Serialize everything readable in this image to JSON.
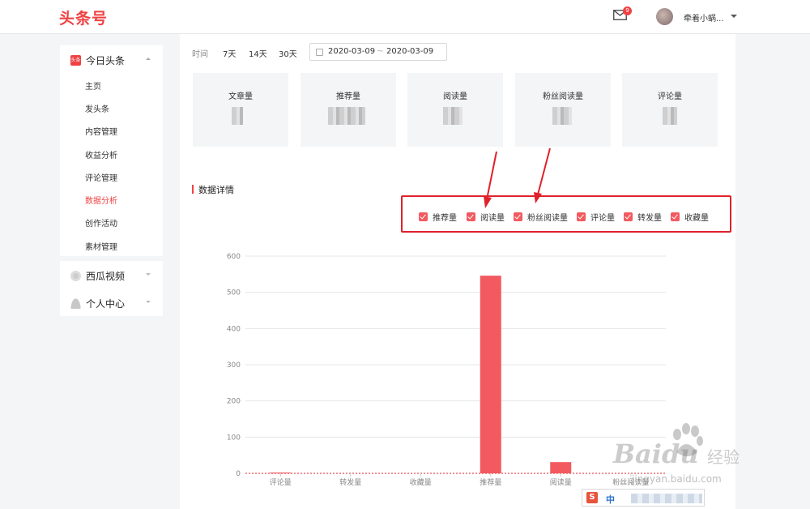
{
  "header": {
    "logo": "头条号",
    "mail_badge": "9",
    "username": "牵着小蜗..."
  },
  "sidebar": {
    "group1": {
      "title": "今日头条",
      "icon_text": "头条",
      "items": [
        "主页",
        "发头条",
        "内容管理",
        "收益分析",
        "评论管理",
        "数据分析",
        "创作活动",
        "素材管理"
      ],
      "active": "数据分析"
    },
    "group2": {
      "title": "西瓜视频"
    },
    "group3": {
      "title": "个人中心"
    }
  },
  "filter": {
    "label": "时间",
    "options": [
      "7天",
      "14天",
      "30天"
    ],
    "date_start": "2020-03-09",
    "date_sep": "~",
    "date_end": "2020-03-09"
  },
  "stats": [
    {
      "label": "文章量"
    },
    {
      "label": "推荐量"
    },
    {
      "label": "阅读量"
    },
    {
      "label": "粉丝阅读量"
    },
    {
      "label": "评论量"
    }
  ],
  "section": {
    "title": "数据详情"
  },
  "legend": [
    "推荐量",
    "阅读量",
    "粉丝阅读量",
    "评论量",
    "转发量",
    "收藏量"
  ],
  "colors": {
    "brand": "#f04142",
    "bar": "#f25a5f",
    "highlight": "#e0212b"
  },
  "chart_data": {
    "type": "bar",
    "categories": [
      "评论量",
      "转发量",
      "收藏量",
      "推荐量",
      "阅读量",
      "粉丝阅读量"
    ],
    "values": [
      1,
      0,
      0,
      546,
      31,
      0
    ],
    "ylim": [
      0,
      600
    ],
    "yticks": [
      0,
      100,
      200,
      300,
      400,
      500,
      600
    ],
    "grid": true
  },
  "watermark": {
    "brand": "Baidu",
    "cn": "经验",
    "url": "jingyan.baidu.com"
  },
  "ime": {
    "icon": "S",
    "mode": "中"
  }
}
